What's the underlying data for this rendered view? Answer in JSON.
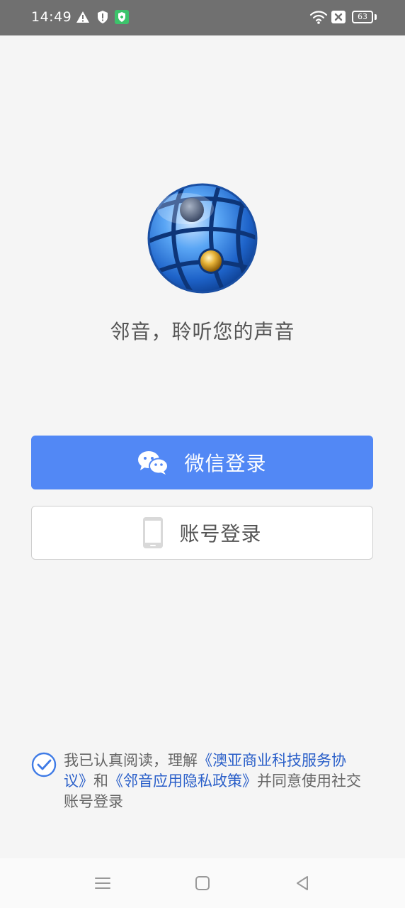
{
  "status_bar": {
    "time": "14:49",
    "battery": "63",
    "icons": [
      "warning-icon",
      "shield-alert-icon",
      "vpn-shield-icon",
      "wifi-icon",
      "sim-off-icon",
      "battery-icon"
    ]
  },
  "logo": {
    "icon": "globe-logo-icon"
  },
  "slogan": "邻音，聆听您的声音",
  "buttons": {
    "wechat_login": "微信登录",
    "account_login": "账号登录"
  },
  "agreement": {
    "checked": true,
    "prefix": "我已认真阅读，理解",
    "link1": "《澳亚商业科技服务协议》",
    "middle": "和",
    "link2": "《邻音应用隐私政策》",
    "suffix": "并同意使用社交账号登录"
  },
  "colors": {
    "primary": "#5288f5",
    "link": "#2a5fc9",
    "status_bar": "#707070",
    "background": "#f5f5f5"
  },
  "nav_bar": {
    "icons": [
      "menu-icon",
      "home-icon",
      "back-icon"
    ]
  }
}
